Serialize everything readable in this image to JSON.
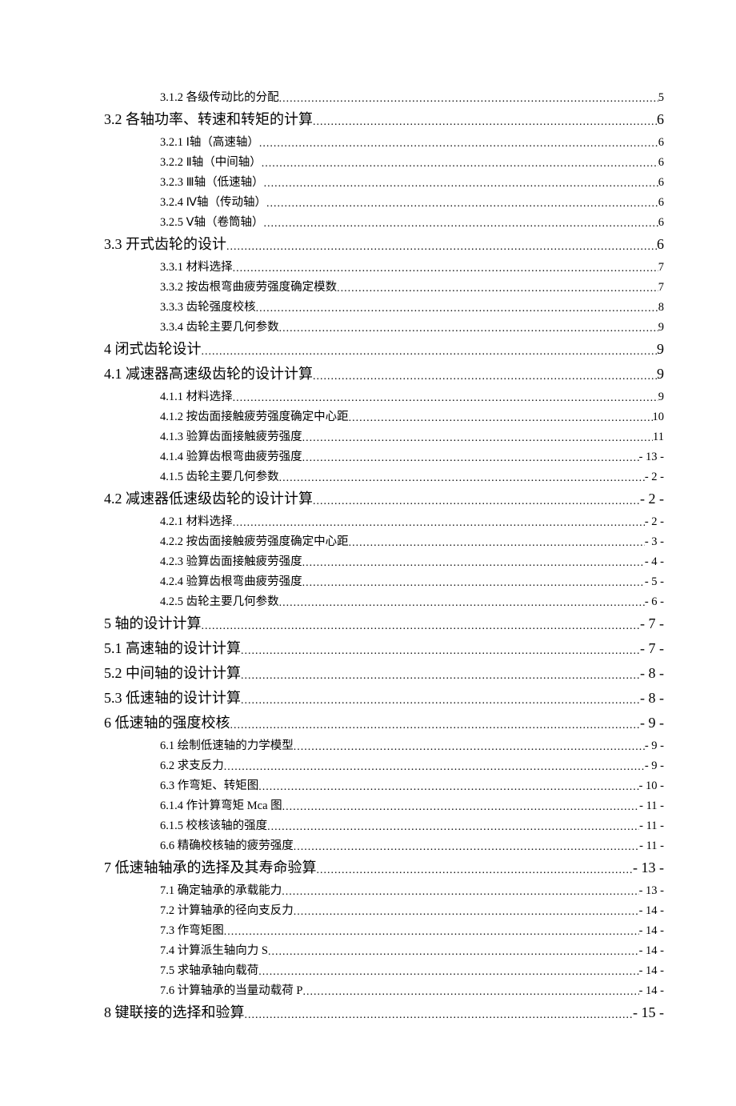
{
  "toc": [
    {
      "level": 3,
      "label": "3.1.2 各级传动比的分配",
      "page": "5"
    },
    {
      "level": 2,
      "label": "3.2 各轴功率、转速和转矩的计算",
      "page": "6"
    },
    {
      "level": 3,
      "label": "3.2.1 Ⅰ轴（高速轴）",
      "page": "6"
    },
    {
      "level": 3,
      "label": "3.2.2 Ⅱ轴（中间轴）",
      "page": "6"
    },
    {
      "level": 3,
      "label": "3.2.3 Ⅲ轴（低速轴）",
      "page": "6"
    },
    {
      "level": 3,
      "label": "3.2.4 Ⅳ轴（传动轴）",
      "page": "6"
    },
    {
      "level": 3,
      "label": "3.2.5 Ⅴ轴（卷筒轴）",
      "page": "6"
    },
    {
      "level": 2,
      "label": "3.3 开式齿轮的设计",
      "page": "6"
    },
    {
      "level": 3,
      "label": "3.3.1 材料选择",
      "page": "7"
    },
    {
      "level": 3,
      "label": "3.3.2 按齿根弯曲疲劳强度确定模数",
      "page": "7"
    },
    {
      "level": 3,
      "label": "3.3.3 齿轮强度校核",
      "page": "8"
    },
    {
      "level": 3,
      "label": "3.3.4 齿轮主要几何参数",
      "page": "9"
    },
    {
      "level": 1,
      "label": "4 闭式齿轮设计",
      "page": "9"
    },
    {
      "level": 2,
      "label": "4.1 减速器高速级齿轮的设计计算",
      "page": "9"
    },
    {
      "level": 3,
      "label": "4.1.1 材料选择",
      "page": "9"
    },
    {
      "level": 3,
      "label": "4.1.2 按齿面接触疲劳强度确定中心距",
      "page": "10"
    },
    {
      "level": 3,
      "label": "4.1.3 验算齿面接触疲劳强度",
      "page": "11"
    },
    {
      "level": 3,
      "label": "4.1.4 验算齿根弯曲疲劳强度",
      "page": "- 13 -"
    },
    {
      "level": 3,
      "label": "4.1.5 齿轮主要几何参数",
      "page": "- 2 -"
    },
    {
      "level": 2,
      "label": "4.2 减速器低速级齿轮的设计计算",
      "page": "- 2 -"
    },
    {
      "level": 3,
      "label": "4.2.1 材料选择",
      "page": "- 2 -"
    },
    {
      "level": 3,
      "label": "4.2.2 按齿面接触疲劳强度确定中心距",
      "page": "- 3 -"
    },
    {
      "level": 3,
      "label": "4.2.3 验算齿面接触疲劳强度",
      "page": "- 4 -"
    },
    {
      "level": 3,
      "label": "4.2.4 验算齿根弯曲疲劳强度",
      "page": "- 5 -"
    },
    {
      "level": 3,
      "label": "4.2.5 齿轮主要几何参数",
      "page": "- 6 -"
    },
    {
      "level": 1,
      "label": "5 轴的设计计算",
      "page": "- 7 -"
    },
    {
      "level": 2,
      "label": "5.1 高速轴的设计计算",
      "page": "- 7 -"
    },
    {
      "level": 2,
      "label": "5.2 中间轴的设计计算",
      "page": "- 8 -"
    },
    {
      "level": 2,
      "label": "5.3 低速轴的设计计算",
      "page": "- 8 -"
    },
    {
      "level": 1,
      "label": "6 低速轴的强度校核",
      "page": "- 9 -"
    },
    {
      "level": 3,
      "label": "6.1 绘制低速轴的力学模型",
      "page": "- 9 -"
    },
    {
      "level": 3,
      "label": "6.2 求支反力",
      "page": "- 9 -"
    },
    {
      "level": 3,
      "label": "6.3 作弯矩、转矩图",
      "page": "- 10 -"
    },
    {
      "level": 3,
      "label": "6.1.4 作计算弯矩 Mca 图",
      "page": "- 11 -"
    },
    {
      "level": 3,
      "label": "6.1.5 校核该轴的强度",
      "page": "- 11 -"
    },
    {
      "level": 3,
      "label": "6.6 精确校核轴的疲劳强度",
      "page": "- 11 -"
    },
    {
      "level": 1,
      "label": "7 低速轴轴承的选择及其寿命验算",
      "page": "- 13 -"
    },
    {
      "level": 3,
      "label": "7.1 确定轴承的承载能力",
      "page": "- 13 -"
    },
    {
      "level": 3,
      "label": "7.2 计算轴承的径向支反力",
      "page": "- 14 -"
    },
    {
      "level": 3,
      "label": "7.3 作弯矩图",
      "page": "- 14 -"
    },
    {
      "level": 3,
      "label": "7.4 计算派生轴向力 S",
      "page": "- 14 -"
    },
    {
      "level": 3,
      "label": "7.5 求轴承轴向载荷",
      "page": "- 14 -"
    },
    {
      "level": 3,
      "label": "7.6 计算轴承的当量动载荷 P",
      "page": "- 14 -"
    },
    {
      "level": 1,
      "label": "8 键联接的选择和验算",
      "page": "- 15 -"
    }
  ]
}
